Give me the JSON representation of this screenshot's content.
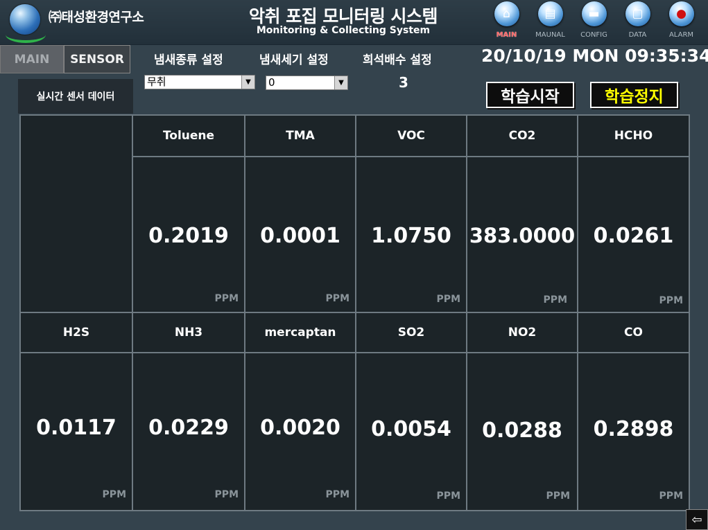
{
  "header": {
    "company": "㈜태성환경연구소",
    "title": "악취 포집 모니터링 시스템",
    "subtitle": "Monitoring & Collecting System",
    "nav": [
      {
        "label": "MAIN",
        "icon": "house-icon"
      },
      {
        "label": "MAUNAL",
        "icon": "manual-icon"
      },
      {
        "label": "CONFIG",
        "icon": "config-icon"
      },
      {
        "label": "DATA",
        "icon": "data-icon"
      },
      {
        "label": "ALARM",
        "icon": "alarm-icon"
      }
    ]
  },
  "tabs": {
    "main": "MAIN",
    "sensor": "SENSOR"
  },
  "settings": {
    "odor_type_label": "냄새종류 설정",
    "odor_type_value": "무취",
    "odor_intensity_label": "냄새세기 설정",
    "odor_intensity_value": "0",
    "dilution_label": "희석배수 설정",
    "dilution_value": "3"
  },
  "datetime": "20/10/19 MON 09:35:34",
  "panel_label": "실시간 센서 데이터",
  "buttons": {
    "start": "학습시작",
    "stop": "학습정지"
  },
  "colors": {
    "stop_text": "#ffff00",
    "active_nav": "#ff6a6a"
  },
  "sensors_row1": [
    {
      "name": "Toluene",
      "value": "0.2019",
      "unit": "PPM"
    },
    {
      "name": "TMA",
      "value": "0.0001",
      "unit": "PPM"
    },
    {
      "name": "VOC",
      "value": "1.0750",
      "unit": "PPM"
    },
    {
      "name": "CO2",
      "value": "383.0000",
      "unit": "PPM"
    },
    {
      "name": "HCHO",
      "value": "0.0261",
      "unit": "PPM"
    }
  ],
  "sensors_row2": [
    {
      "name": "H2S",
      "value": "0.0117",
      "unit": "PPM"
    },
    {
      "name": "NH3",
      "value": "0.0229",
      "unit": "PPM"
    },
    {
      "name": "mercaptan",
      "value": "0.0020",
      "unit": "PPM"
    },
    {
      "name": "SO2",
      "value": "0.0054",
      "unit": "PPM"
    },
    {
      "name": "NO2",
      "value": "0.0288",
      "unit": "PPM"
    },
    {
      "name": "CO",
      "value": "0.2898",
      "unit": "PPM"
    }
  ]
}
